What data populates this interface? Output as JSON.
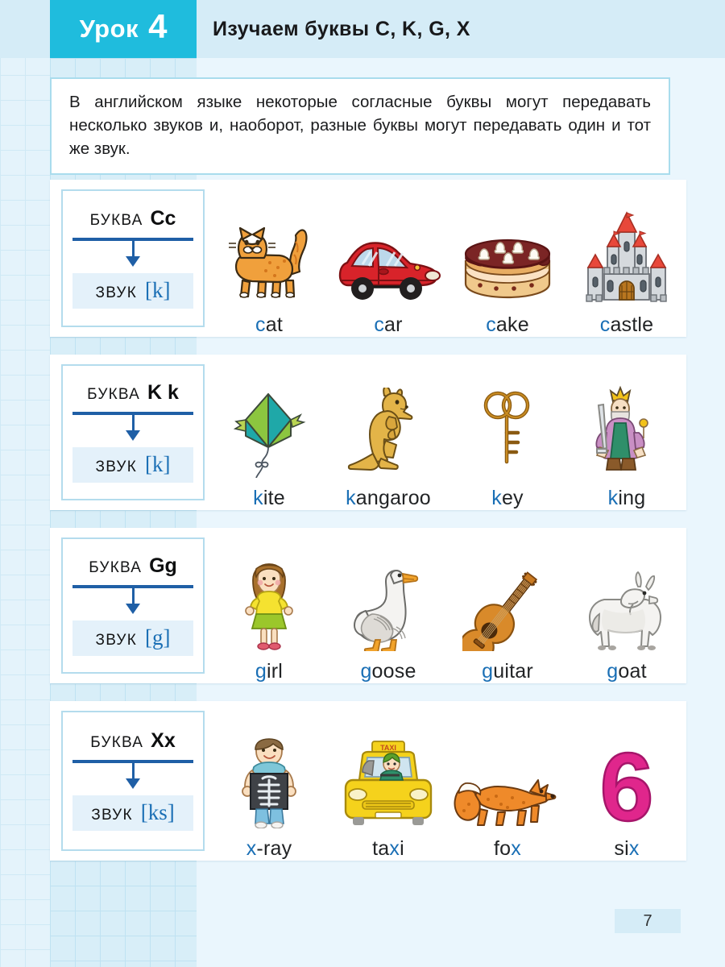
{
  "header": {
    "lesson_word": "Урок",
    "lesson_number": "4",
    "title": "Изучаем буквы C, K, G, X",
    "tab_color": "#1fbcdd",
    "band_color": "#d5ecf7"
  },
  "intro": {
    "text": "В английском языке некоторые согласные буквы могут передавать несколько звуков и, наоборот, разные буквы могут передавать один и тот же звук."
  },
  "letter_label": "БУКВА",
  "sound_label": "ЗВУК",
  "accent_color": "#1a6fb5",
  "rows": [
    {
      "letter": "Cc",
      "sound": "[k]",
      "items": [
        {
          "word": "cat",
          "pre": "",
          "hl": "c",
          "post": "at",
          "icon": "cat-icon"
        },
        {
          "word": "car",
          "pre": "",
          "hl": "c",
          "post": "ar",
          "icon": "car-icon"
        },
        {
          "word": "cake",
          "pre": "",
          "hl": "c",
          "post": "ake",
          "icon": "cake-icon"
        },
        {
          "word": "castle",
          "pre": "",
          "hl": "c",
          "post": "astle",
          "icon": "castle-icon"
        }
      ]
    },
    {
      "letter": "K k",
      "sound": "[k]",
      "items": [
        {
          "word": "kite",
          "pre": "",
          "hl": "k",
          "post": "ite",
          "icon": "kite-icon"
        },
        {
          "word": "kangaroo",
          "pre": "",
          "hl": "k",
          "post": "angaroo",
          "icon": "kangaroo-icon"
        },
        {
          "word": "key",
          "pre": "",
          "hl": "k",
          "post": "ey",
          "icon": "key-icon"
        },
        {
          "word": "king",
          "pre": "",
          "hl": "k",
          "post": "ing",
          "icon": "king-icon"
        }
      ]
    },
    {
      "letter": "Gg",
      "sound": "[g]",
      "items": [
        {
          "word": "girl",
          "pre": "",
          "hl": "g",
          "post": "irl",
          "icon": "girl-icon"
        },
        {
          "word": "goose",
          "pre": "",
          "hl": "g",
          "post": "oose",
          "icon": "goose-icon"
        },
        {
          "word": "guitar",
          "pre": "",
          "hl": "g",
          "post": "uitar",
          "icon": "guitar-icon"
        },
        {
          "word": "goat",
          "pre": "",
          "hl": "g",
          "post": "oat",
          "icon": "goat-icon"
        }
      ]
    },
    {
      "letter": "Xx",
      "sound": "[ks]",
      "items": [
        {
          "word": "x-ray",
          "pre": "",
          "hl": "x",
          "post": "-ray",
          "icon": "xray-icon"
        },
        {
          "word": "taxi",
          "pre": "ta",
          "hl": "x",
          "post": "i",
          "icon": "taxi-icon"
        },
        {
          "word": "fox",
          "pre": "fo",
          "hl": "x",
          "post": "",
          "icon": "fox-icon"
        },
        {
          "word": "six",
          "pre": "si",
          "hl": "x",
          "post": "",
          "icon": "six-icon"
        }
      ]
    }
  ],
  "page_number": "7"
}
